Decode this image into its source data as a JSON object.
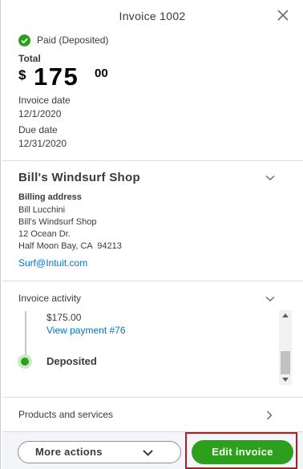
{
  "header": {
    "title": "Invoice 1002"
  },
  "status": {
    "text": "Paid (Deposited)",
    "color": "#2ca01c"
  },
  "summary": {
    "total_label": "Total",
    "currency_symbol": "$",
    "amount_whole": "175",
    "amount_cents": "00",
    "invoice_date_label": "Invoice date",
    "invoice_date": "12/1/2020",
    "due_date_label": "Due date",
    "due_date": "12/31/2020"
  },
  "customer": {
    "name": "Bill's Windsurf Shop",
    "billing_label": "Billing address",
    "address_lines": [
      "Bill Lucchini",
      "Bill's Windsurf Shop",
      "12 Ocean Dr.",
      "Half Moon Bay, CA  94213"
    ],
    "email": "Surf@Intuit.com"
  },
  "activity": {
    "title": "Invoice activity",
    "amount": "$175.00",
    "payment_link": "View payment #76",
    "status": "Deposited"
  },
  "products": {
    "label": "Products and services"
  },
  "footer": {
    "more_actions_label": "More actions",
    "edit_invoice_label": "Edit invoice"
  },
  "colors": {
    "brand_green": "#2ca01c",
    "link_blue": "#0077c5",
    "highlight_red": "#b41a1f"
  },
  "icons": {
    "close": "close-icon",
    "status": "check-circle-icon",
    "expand": "chevron-down-icon",
    "navigate": "chevron-right-icon"
  }
}
